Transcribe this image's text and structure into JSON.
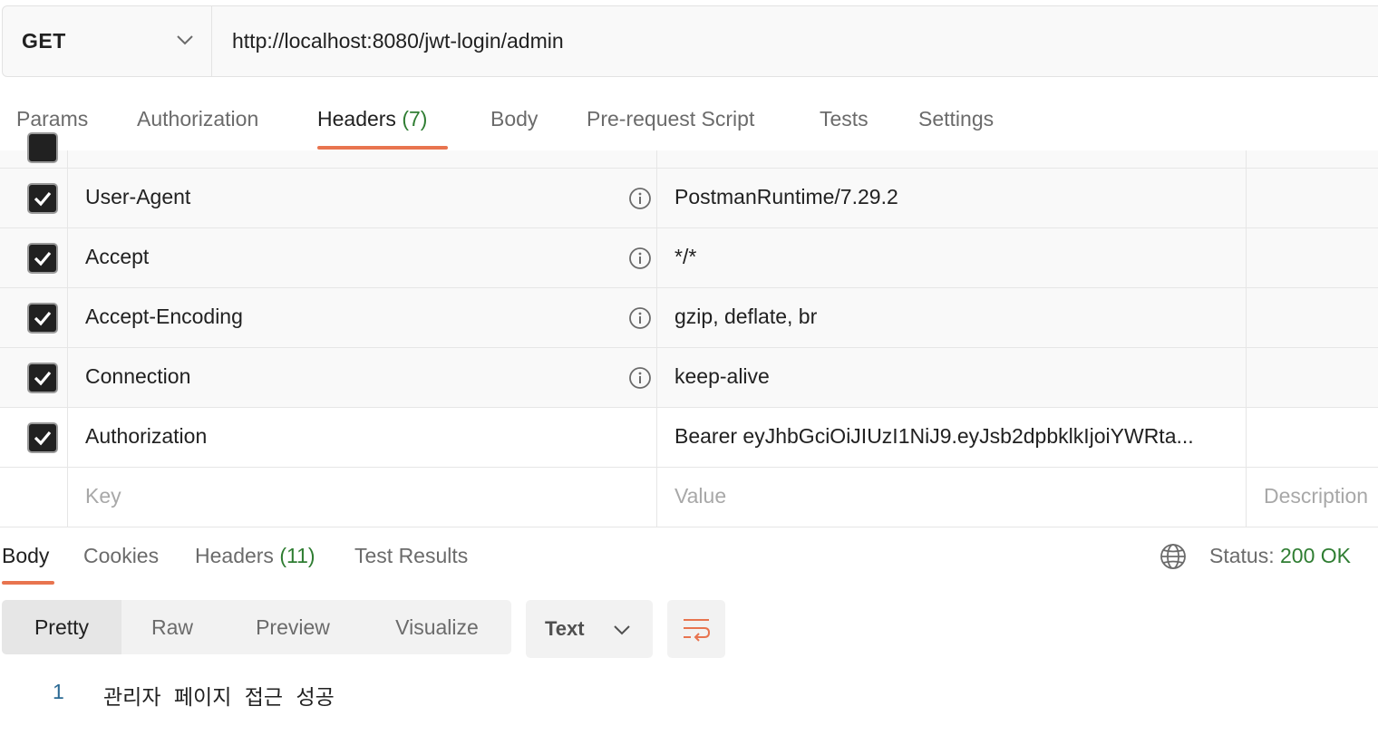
{
  "request": {
    "method": "GET",
    "url": "http://localhost:8080/jwt-login/admin"
  },
  "request_tabs": [
    {
      "label": "Params",
      "count": ""
    },
    {
      "label": "Authorization",
      "count": ""
    },
    {
      "label": "Headers",
      "count": "(7)"
    },
    {
      "label": "Body",
      "count": ""
    },
    {
      "label": "Pre-request Script",
      "count": ""
    },
    {
      "label": "Tests",
      "count": ""
    },
    {
      "label": "Settings",
      "count": ""
    }
  ],
  "active_request_tab": "Headers",
  "headers": [
    {
      "checked": true,
      "key": "User-Agent",
      "value": "PostmanRuntime/7.29.2",
      "auto": true
    },
    {
      "checked": true,
      "key": "Accept",
      "value": "*/*",
      "auto": true
    },
    {
      "checked": true,
      "key": "Accept-Encoding",
      "value": "gzip, deflate, br",
      "auto": true
    },
    {
      "checked": true,
      "key": "Connection",
      "value": "keep-alive",
      "auto": true
    },
    {
      "checked": true,
      "key": "Authorization",
      "value": "Bearer eyJhbGciOiJIUzI1NiJ9.eyJsb2dpbklkIjoiYWRta...",
      "auto": false
    }
  ],
  "new_row": {
    "key_placeholder": "Key",
    "value_placeholder": "Value",
    "description_placeholder": "Description"
  },
  "response_tabs": [
    {
      "label": "Body",
      "count": ""
    },
    {
      "label": "Cookies",
      "count": ""
    },
    {
      "label": "Headers",
      "count": "(11)"
    },
    {
      "label": "Test Results",
      "count": ""
    }
  ],
  "status": {
    "label": "Status:",
    "value": "200 OK"
  },
  "view_modes": [
    "Pretty",
    "Raw",
    "Preview",
    "Visualize"
  ],
  "active_view_mode": "Pretty",
  "format": "Text",
  "response_body": [
    {
      "line": "1",
      "text": "관리자 페이지 접근 성공"
    }
  ],
  "colors": {
    "accent": "#e8744f",
    "count_green": "#2f7d32",
    "line_number": "#2b6a94"
  },
  "icons": [
    "chevron-down-icon",
    "checkbox-checked-icon",
    "info-icon",
    "globe-icon",
    "wrap-lines-icon"
  ]
}
